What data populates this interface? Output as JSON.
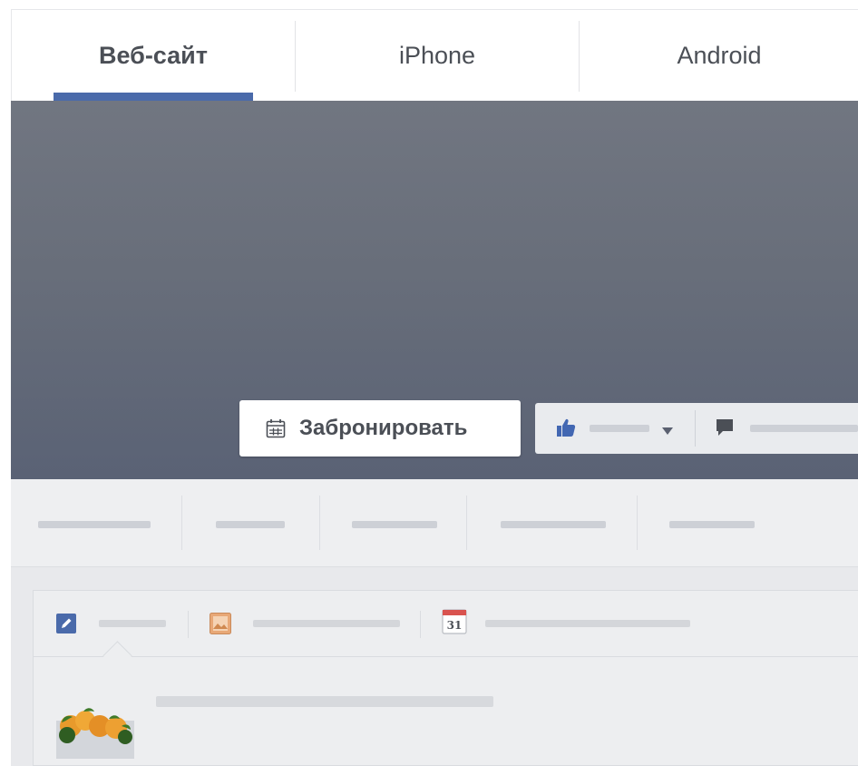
{
  "tabs": [
    {
      "label": "Веб-сайт",
      "active": true
    },
    {
      "label": "iPhone",
      "active": false
    },
    {
      "label": "Android",
      "active": false
    }
  ],
  "colors": {
    "accent": "#4a6aaa",
    "cover_top": "#717681",
    "cover_bottom": "#5a6275",
    "like_blue": "#4267b2",
    "text": "#4b4f56"
  },
  "cover": {
    "cta_button": {
      "label": "Забронировать",
      "icon": "calendar-icon"
    },
    "like_button": {
      "icon": "thumbs-up-icon",
      "dropdown_icon": "caret-down-icon"
    },
    "message_button": {
      "icon": "speech-bubble-icon"
    }
  },
  "composer": {
    "tabs": [
      {
        "icon": "pencil-icon"
      },
      {
        "icon": "photo-icon"
      },
      {
        "icon": "calendar-icon",
        "text": "31"
      }
    ]
  }
}
